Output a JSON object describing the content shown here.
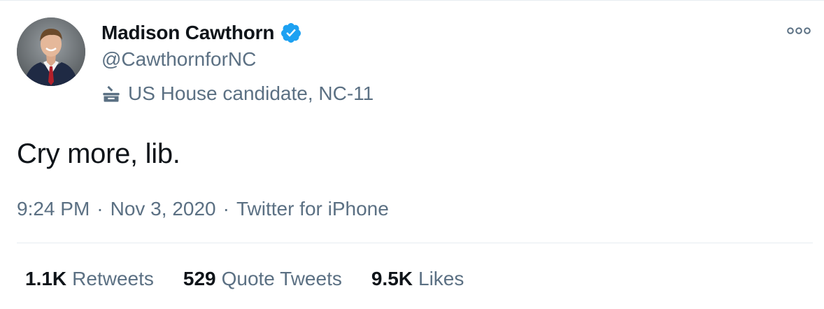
{
  "user": {
    "display_name": "Madison Cawthorn",
    "handle": "@CawthornforNC",
    "label": "US House candidate, NC-11",
    "verified_icon": "verified-badge-icon",
    "label_icon": "ballot-box-icon"
  },
  "tweet": {
    "text": "Cry more, lib."
  },
  "meta": {
    "time": "9:24 PM",
    "separator": "·",
    "date": "Nov 3, 2020",
    "source": "Twitter for iPhone"
  },
  "stats": [
    {
      "count": "1.1K",
      "label": "Retweets"
    },
    {
      "count": "529",
      "label": "Quote Tweets"
    },
    {
      "count": "9.5K",
      "label": "Likes"
    }
  ],
  "colors": {
    "text_primary": "#0f1419",
    "text_secondary": "#5b7083",
    "verified_blue": "#1da1f2",
    "divider": "#e6ecf0"
  },
  "icons": {
    "more": "more-options-icon"
  }
}
